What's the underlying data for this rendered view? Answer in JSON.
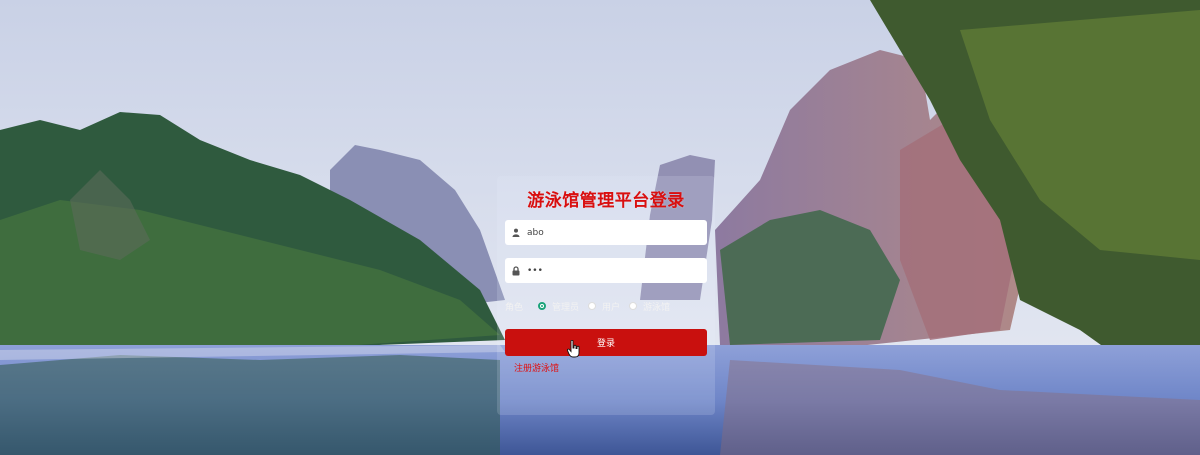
{
  "login": {
    "title": "游泳馆管理平台登录",
    "username": {
      "value": "abo",
      "icon": "user-icon"
    },
    "password": {
      "value": "•••",
      "icon": "lock-icon"
    },
    "role": {
      "label": "角色",
      "options": [
        "管理员",
        "用户",
        "游泳馆"
      ],
      "selected": "管理员"
    },
    "login_button": "登录",
    "register_link": "注册游泳馆"
  },
  "colors": {
    "title": "#d90f0f",
    "button": "#c9100e",
    "link": "#e01010",
    "radio_selected": "#1aa37a"
  }
}
